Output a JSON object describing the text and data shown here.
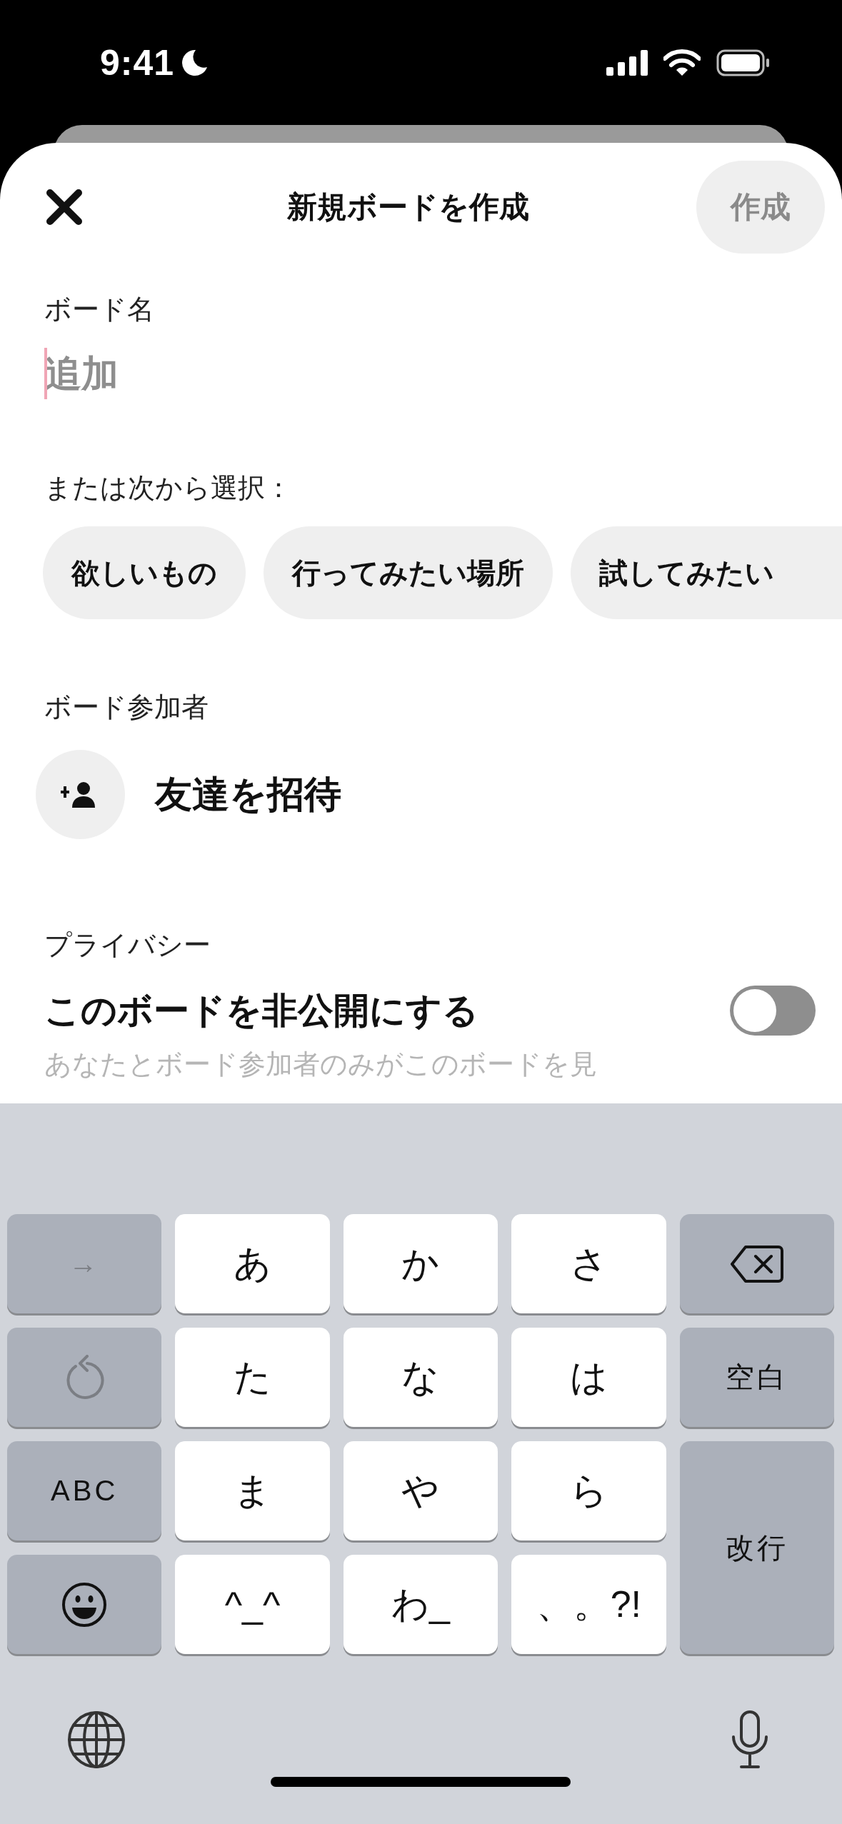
{
  "status_bar": {
    "time": "9:41"
  },
  "header": {
    "title": "新規ボードを作成",
    "create_button": {
      "label": "作成",
      "disabled": true
    }
  },
  "board_name": {
    "label": "ボード名",
    "placeholder": "追加"
  },
  "suggestions": {
    "label": "または次から選択：",
    "chips": [
      "欲しいもの",
      "行ってみたい場所",
      "試してみたい"
    ]
  },
  "collaborators": {
    "label": "ボード参加者",
    "invite_label": "友達を招待"
  },
  "privacy": {
    "label": "プライバシー",
    "title": "このボードを非公開にする",
    "on": false,
    "description": "あなたとボード参加者のみがこのボードを見"
  },
  "keyboard": {
    "keys": [
      {
        "kind": "action",
        "label": "→",
        "disabled": true
      },
      {
        "kind": "kana",
        "label": "あ",
        "disabled": false
      },
      {
        "kind": "kana",
        "label": "か",
        "disabled": false
      },
      {
        "kind": "kana",
        "label": "さ",
        "disabled": false
      },
      {
        "kind": "backspace",
        "disabled": false
      },
      {
        "kind": "undo",
        "disabled": true
      },
      {
        "kind": "kana",
        "label": "た",
        "disabled": false
      },
      {
        "kind": "kana",
        "label": "な",
        "disabled": false
      },
      {
        "kind": "kana",
        "label": "は",
        "disabled": false
      },
      {
        "kind": "action",
        "label": "空白",
        "disabled": false
      },
      {
        "kind": "action",
        "label": "ABC",
        "disabled": false
      },
      {
        "kind": "kana",
        "label": "ま",
        "disabled": false
      },
      {
        "kind": "kana",
        "label": "や",
        "disabled": false
      },
      {
        "kind": "kana",
        "label": "ら",
        "disabled": false
      },
      {
        "kind": "return",
        "label": "改行",
        "disabled": false
      },
      {
        "kind": "emoji",
        "disabled": false
      },
      {
        "kind": "kana",
        "label": "^_^",
        "disabled": false
      },
      {
        "kind": "kana",
        "label": "わ_",
        "disabled": false
      },
      {
        "kind": "kana",
        "label": "、。?!",
        "disabled": false
      }
    ]
  }
}
